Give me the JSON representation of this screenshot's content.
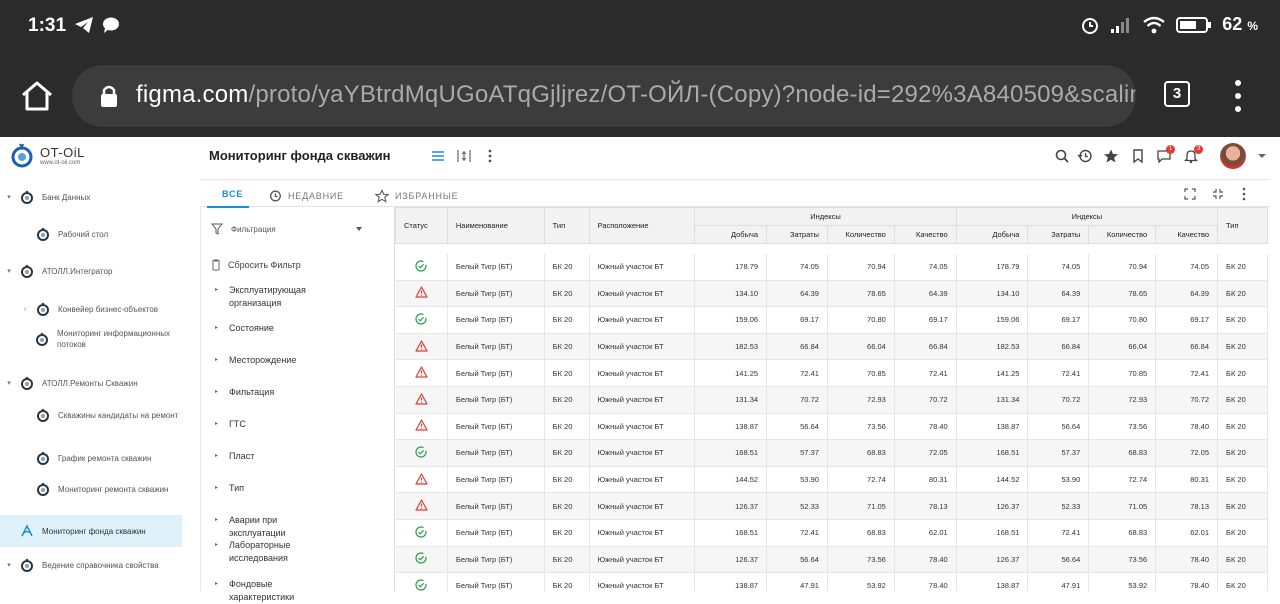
{
  "status_bar": {
    "time": "1:31",
    "battery": "62",
    "battery_unit": "%"
  },
  "browser": {
    "url_host": "figma.com",
    "url_path": "/proto/yaYBtrdMqUGoATqGjljrez/OT-ОЙЛ-(Copy)?node-id=292%3A840509&scalin",
    "tab_count": "3"
  },
  "logo": {
    "name": "OT-OiL",
    "sub": "www.ot-oil.com"
  },
  "sidebar": {
    "items": [
      {
        "label": "Банк Данных",
        "level": 0,
        "caret": "▾"
      },
      {
        "label": "Рабочий стол",
        "level": 1
      },
      {
        "label": "АТОЛЛ.Интегратор",
        "level": 0,
        "caret": "▾"
      },
      {
        "label": "Конвейер бизнес-объектов",
        "level": 1,
        "caret": "›"
      },
      {
        "label": "Мониторинг информационных потоков",
        "level": 1
      },
      {
        "label": "АТОЛЛ.Ремонты Скважин",
        "level": 0,
        "caret": "▾"
      },
      {
        "label": "Скважины кандидаты на ремонт",
        "level": 1
      },
      {
        "label": "График ремонта скважин",
        "level": 1
      },
      {
        "label": "Мониторинг ремонта скважин",
        "level": 1
      },
      {
        "label": "Мониторинг фонда скважин",
        "level": 0,
        "active": true
      },
      {
        "label": "Ведение справочника свойства",
        "level": 0,
        "caret": "▾"
      }
    ]
  },
  "header": {
    "title": "Мониторинг фонда скважин",
    "badge_1": "1",
    "badge_2": "3"
  },
  "tabs": {
    "all": "ВСЕ",
    "recent": "НЕДАВНИЕ",
    "favorites": "ИЗБРАННЫЕ"
  },
  "filter": {
    "title": "Фильтрация",
    "reset": "Сбросить Фильтр",
    "items": [
      "Эксплуатирующая организация",
      "Состояние",
      "Месторождение",
      "Фильтация",
      "ГТС",
      "Пласт",
      "Тип",
      "Аварии при эксплуатации",
      "Лабораторные исследования",
      "Фондовые характеристики"
    ]
  },
  "table": {
    "headers": {
      "status": "Статус",
      "name": "Наименование",
      "type": "Тип",
      "location": "Расположение",
      "group1": "Индексы",
      "group2": "Индексы",
      "sub": [
        "Добыча",
        "Затраты",
        "Количество",
        "Качество"
      ],
      "type2": "Тип"
    },
    "rows": [
      {
        "status": "ok",
        "name": "Белый Тигр (БТ)",
        "type": "БК 20",
        "loc": "Южный участок БТ",
        "v": [
          "178.79",
          "74.05",
          "70.94",
          "74.05"
        ],
        "type2": "БК 20"
      },
      {
        "status": "warn",
        "name": "Белый Тигр (БТ)",
        "type": "БК 20",
        "loc": "Южный участок БТ",
        "v": [
          "134.10",
          "64.39",
          "78.65",
          "64.39"
        ],
        "type2": "БК 20"
      },
      {
        "status": "ok",
        "name": "Белый Тигр (БТ)",
        "type": "БК 20",
        "loc": "Южный участок БТ",
        "v": [
          "159.06",
          "69.17",
          "70.80",
          "69.17"
        ],
        "type2": "БК 20"
      },
      {
        "status": "warn",
        "name": "Белый Тигр (БТ)",
        "type": "БК 20",
        "loc": "Южный участок БТ",
        "v": [
          "182.53",
          "66.84",
          "66.04",
          "66.84"
        ],
        "type2": "БК 20"
      },
      {
        "status": "warn",
        "name": "Белый Тигр (БТ)",
        "type": "БК 20",
        "loc": "Южный участок БТ",
        "v": [
          "141.25",
          "72.41",
          "70.85",
          "72.41"
        ],
        "type2": "БК 20"
      },
      {
        "status": "warn",
        "name": "Белый Тигр (БТ)",
        "type": "БК 20",
        "loc": "Южный участок БТ",
        "v": [
          "131.34",
          "70.72",
          "72.93",
          "70.72"
        ],
        "type2": "БК 20"
      },
      {
        "status": "warn",
        "name": "Белый Тигр (БТ)",
        "type": "БК 20",
        "loc": "Южный участок БТ",
        "v": [
          "138.87",
          "56.64",
          "73.56",
          "78.40"
        ],
        "type2": "БК 20"
      },
      {
        "status": "ok",
        "name": "Белый Тигр (БТ)",
        "type": "БК 20",
        "loc": "Южный участок БТ",
        "v": [
          "168.51",
          "57.37",
          "68.83",
          "72.05"
        ],
        "type2": "БК 20"
      },
      {
        "status": "warn",
        "name": "Белый Тигр (БТ)",
        "type": "БК 20",
        "loc": "Южный участок БТ",
        "v": [
          "144.52",
          "53.90",
          "72.74",
          "80.31"
        ],
        "type2": "БК 20"
      },
      {
        "status": "warn",
        "name": "Белый Тигр (БТ)",
        "type": "БК 20",
        "loc": "Южный участок БТ",
        "v": [
          "126.37",
          "52.33",
          "71.05",
          "78.13"
        ],
        "type2": "БК 20"
      },
      {
        "status": "ok",
        "name": "Белый Тигр (БТ)",
        "type": "БК 20",
        "loc": "Южный участок БТ",
        "v": [
          "168.51",
          "72.41",
          "68.83",
          "62.01"
        ],
        "type2": "БК 20"
      },
      {
        "status": "ok",
        "name": "Белый Тигр (БТ)",
        "type": "БК 20",
        "loc": "Южный участок БТ",
        "v": [
          "126.37",
          "56.64",
          "73.56",
          "78.40"
        ],
        "type2": "БК 20"
      },
      {
        "status": "ok",
        "name": "Белый Тигр (БТ)",
        "type": "БК 20",
        "loc": "Южный участок БТ",
        "v": [
          "138.87",
          "47.91",
          "53.92",
          "78.40"
        ],
        "type2": "БК 20"
      }
    ]
  },
  "colors": {
    "accent": "#1a8bd6",
    "ok": "#2e9e4f",
    "warn": "#e53935",
    "chrome_bg": "#2b2b2b"
  }
}
